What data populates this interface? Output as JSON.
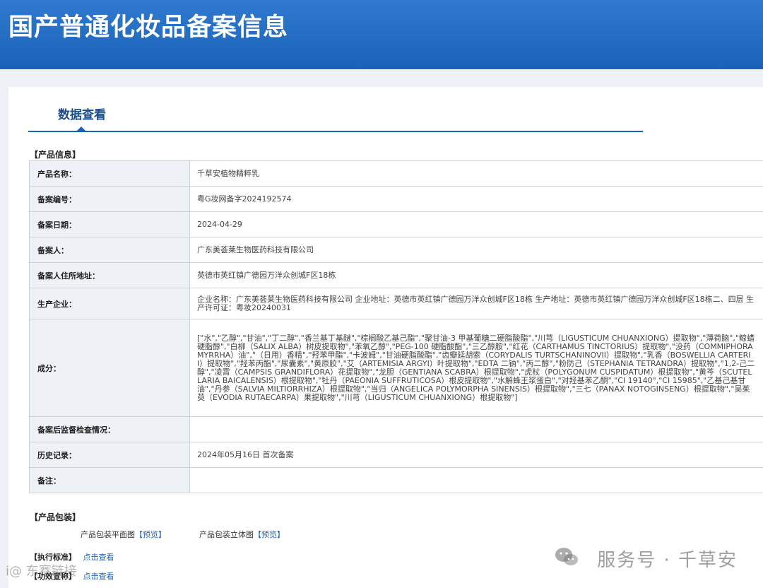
{
  "header": {
    "title": "国产普通化妆品备案信息"
  },
  "tab": {
    "label": "数据查看"
  },
  "sections": {
    "product_info": "【产品信息】",
    "product_package": "【产品包装】",
    "execution_standard": "【执行标准】",
    "efficacy_claim": "【功效宣称】"
  },
  "rows": [
    {
      "key": "产品名称：",
      "value": "千草安植物精粹乳"
    },
    {
      "key": "备案编号：",
      "value": "粤G妆网备字2024192574"
    },
    {
      "key": "备案日期：",
      "value": "2024-04-29"
    },
    {
      "key": "备案人：",
      "value": "广东美荟莱生物医药科技有限公司"
    },
    {
      "key": "备案人住所地址：",
      "value": "英德市英红镇广德园万洋众创城F区18栋"
    },
    {
      "key": "生产企业：",
      "value": "企业名称：广东美荟莱生物医药科技有限公司 企业地址：英德市英红镇广德园万洋众创城F区18栋 生产地址：英德市英红镇广德园万洋众创城F区18栋二、四层 生产许可证：粤妆20240031"
    },
    {
      "key": "成分：",
      "value": "[\"水\",\"乙醇\",\"甘油\",\"丁二醇\",\"香兰基丁基醚\",\"棕榈酸乙基己酯\",\"聚甘油-3 甲基葡糖二硬脂酸酯\",\"川芎（LIGUSTICUM CHUANXIONG）提取物\",\"薄荷脑\",\"鲸蜡硬脂醇\",\"白柳（SALIX ALBA）树皮提取物\",\"苯氧乙醇\",\"PEG-100 硬脂酸酯\",\"三乙醇胺\",\"红花（CARTHAMUS TINCTORIUS）提取物\",\"没药（COMMIPHORA MYRRHA）油\",\"（日用）香精\",\"羟苯甲酯\",\"卡波姆\",\"甘油硬脂酸酯\",\"齿瓣延胡索（CORYDALIS TURTSCHANINOVII）提取物\",\"乳香（BOSWELLIA CARTERII）提取物\",\"羟苯丙酯\",\"尿囊素\",\"黄原胶\",\"艾（ARTEMISIA ARGYI）叶提取物\",\"EDTA 二钠\",\"丙二醇\",\"粉防己（STEPHANIA TETRANDRA）提取物\",\"1,2-己二醇\",\"凌霄（CAMPSIS GRANDIFLORA）花提取物\",\"龙胆（GENTIANA SCABRA）根提取物\",\"虎杖（POLYGONUM CUSPIDATUM）根提取物\",\"黄芩（SCUTELLARIA BAICALENSIS）根提取物\",\"牡丹（PAEONIA SUFFRUTICOSA）根皮提取物\",\"水解蜂王浆蛋白\",\"对羟基苯乙酮\",\"CI 19140\",\"CI 15985\",\"乙基己基甘油\",\"丹参（SALVIA MILTIORRHIZA）根提取物\",\"当归（ANGELICA POLYMORPHA SINENSIS）根提取物\",\"三七（PANAX NOTOGINSENG）根提取物\",\"吴茱萸（EVODIA RUTAECARPA）果提取物\",\"川芎（LIGUSTICUM CHUANXIONG）根提取物\"]"
    },
    {
      "key": "备案后监督检查情况：",
      "value": ""
    },
    {
      "key": "历史记录：",
      "value": "2024年05月16日 首次备案"
    },
    {
      "key": "备注：",
      "value": ""
    }
  ],
  "package": {
    "flat_label": "产品包装平面图",
    "flat_link": "【预览】",
    "solid_label": "产品包装立体图",
    "solid_link": "【预览】"
  },
  "standard_link": "点击查看",
  "efficacy_link": "点击查看",
  "watermark": {
    "text": "服务号 · 千草安",
    "left_text": "i@ 东赛链接"
  },
  "colors": {
    "header": "#1a62b8",
    "link": "#1a62b8",
    "key_bg": "#eef1f6",
    "border": "#c9d3e0"
  }
}
